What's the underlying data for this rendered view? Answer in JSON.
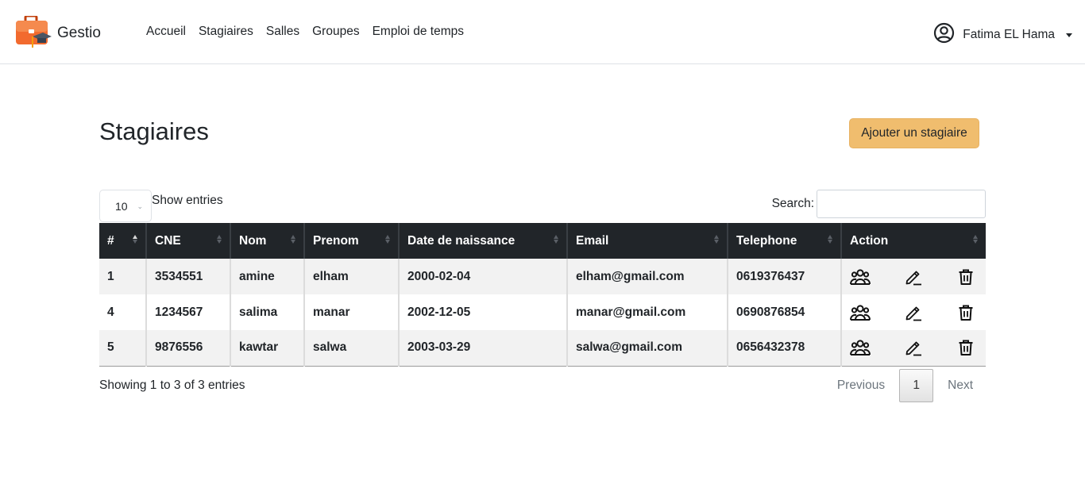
{
  "brand": {
    "name": "Gestio",
    "icon": "briefcase-graduation-logo"
  },
  "nav": {
    "links": [
      "Accueil",
      "Stagiaires",
      "Salles",
      "Groupes",
      "Emploi de temps"
    ]
  },
  "user": {
    "name": "Fatima EL Hama",
    "icon": "user-circle-icon"
  },
  "page": {
    "title": "Stagiaires",
    "add_button": "Ajouter un stagiaire",
    "accent_color": "#f0bd6e"
  },
  "table_controls": {
    "page_length": "10",
    "show_entries": "Show entries",
    "search_label": "Search:",
    "search_value": ""
  },
  "table": {
    "columns": [
      "#",
      "CNE",
      "Nom",
      "Prenom",
      "Date de naissance",
      "Email",
      "Telephone",
      "Action"
    ],
    "rows": [
      {
        "id": "1",
        "cne": "3534551",
        "nom": "amine",
        "prenom": "elham",
        "date": "2000-02-04",
        "email": "elham@gmail.com",
        "tel": "0619376437"
      },
      {
        "id": "4",
        "cne": "1234567",
        "nom": "salima",
        "prenom": "manar",
        "date": "2002-12-05",
        "email": "manar@gmail.com",
        "tel": "0690876854"
      },
      {
        "id": "5",
        "cne": "9876556",
        "nom": "kawtar",
        "prenom": "salwa",
        "date": "2003-03-29",
        "email": "salwa@gmail.com",
        "tel": "0656432378"
      }
    ],
    "row_action_icons": [
      "group-icon",
      "edit-pencil-icon",
      "trash-icon"
    ]
  },
  "footer": {
    "info": "Showing 1 to 3 of 3 entries",
    "previous": "Previous",
    "current_page": "1",
    "next": "Next"
  }
}
